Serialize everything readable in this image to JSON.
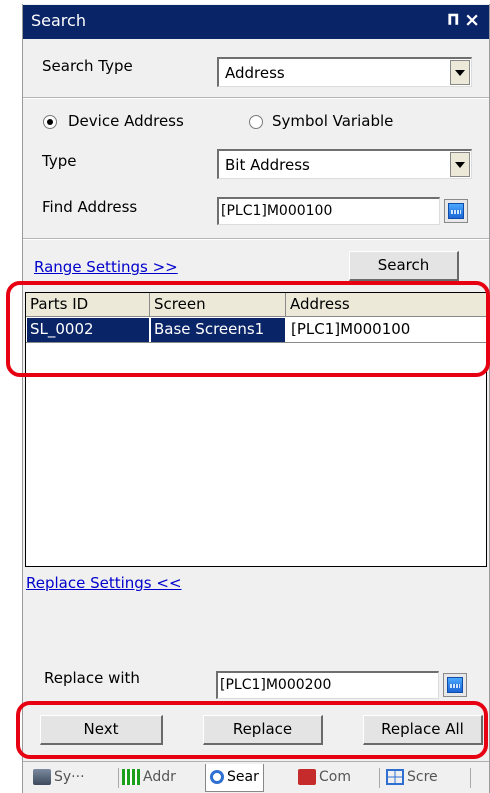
{
  "window": {
    "title": "Search"
  },
  "search_type": {
    "label": "Search Type",
    "value": "Address"
  },
  "address_mode": {
    "options": [
      "Device Address",
      "Symbol Variable"
    ],
    "selected": "Device Address"
  },
  "type_field": {
    "label": "Type",
    "value": "Bit Address"
  },
  "find_address": {
    "label": "Find Address",
    "value": "[PLC1]M000100"
  },
  "range_settings_link": "Range Settings >>",
  "search_button": "Search",
  "results": {
    "columns": [
      "Parts ID",
      "Screen",
      "Address"
    ],
    "rows": [
      {
        "parts_id": "SL_0002",
        "screen": "Base Screens1",
        "address": "[PLC1]M000100"
      }
    ]
  },
  "replace_settings_link": "Replace Settings <<",
  "replace_with": {
    "label": "Replace with",
    "value": "[PLC1]M000200"
  },
  "buttons": {
    "next": "Next",
    "replace": "Replace",
    "replace_all": "Replace All"
  },
  "bottom_tabs": [
    {
      "label": "Sy···",
      "icon": "symbol-variable-icon"
    },
    {
      "label": "Addr",
      "icon": "address-grid-icon"
    },
    {
      "label": "Sear",
      "icon": "search-magnifier-icon",
      "active": true
    },
    {
      "label": "Com",
      "icon": "common-settings-icon"
    },
    {
      "label": "Scre",
      "icon": "screen-list-icon"
    }
  ],
  "highlight_color": "#e60012",
  "accent_color": "#0a2468"
}
